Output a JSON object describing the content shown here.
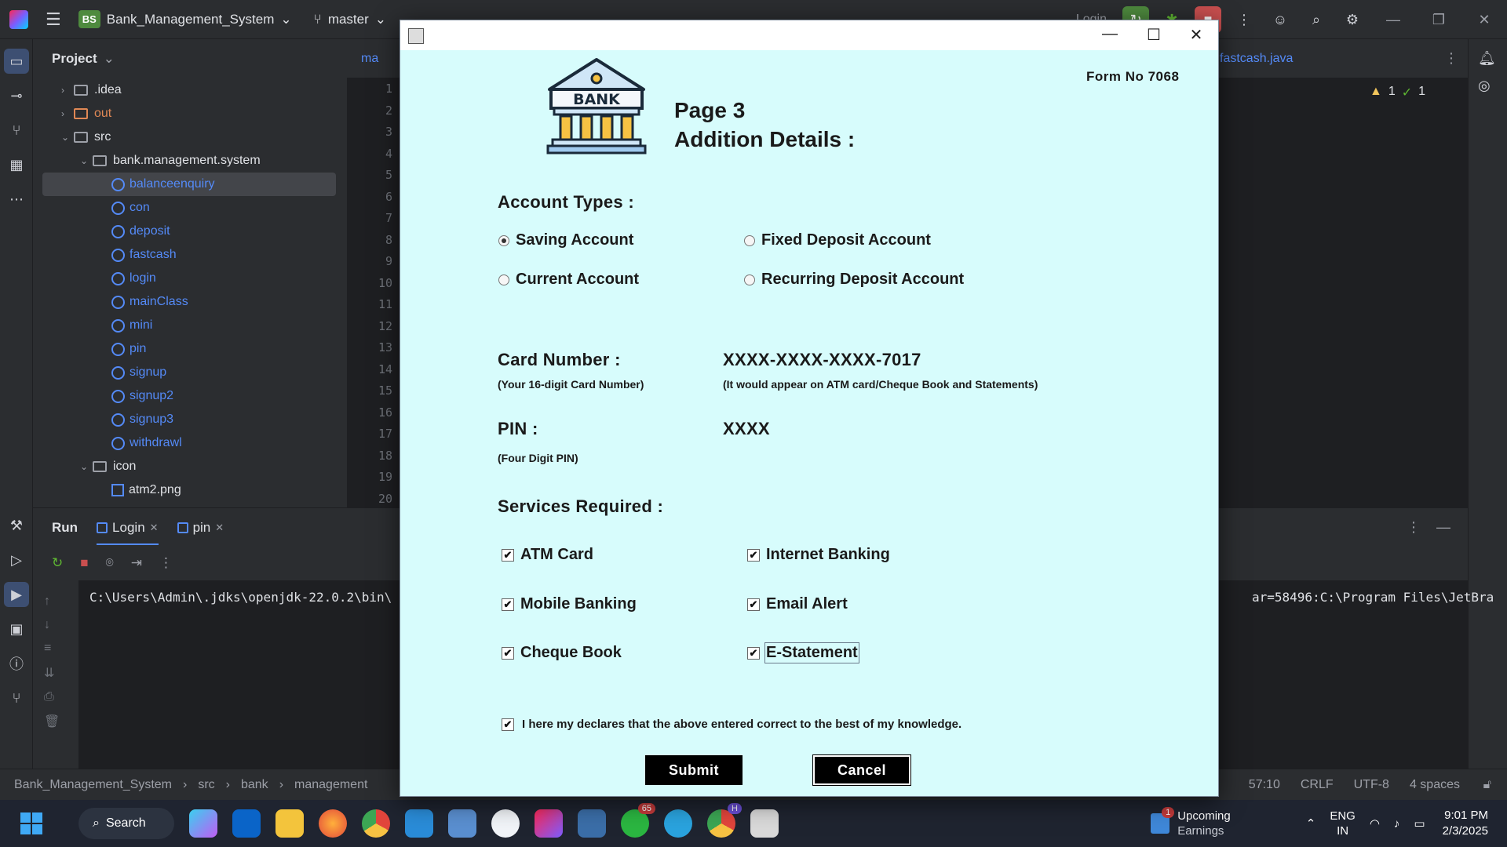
{
  "ide": {
    "project_name": "Bank_Management_System",
    "project_badge": "BS",
    "branch": "master",
    "run_config": "Login",
    "project_panel_title": "Project",
    "tree": [
      {
        "label": ".idea",
        "kind": "folder",
        "depth": 1,
        "chevron": "›"
      },
      {
        "label": "out",
        "kind": "folder-excluded",
        "depth": 1,
        "chevron": "›"
      },
      {
        "label": "src",
        "kind": "folder",
        "depth": 1,
        "chevron": "⌄"
      },
      {
        "label": "bank.management.system",
        "kind": "package",
        "depth": 2,
        "chevron": "⌄"
      },
      {
        "label": "balanceenquiry",
        "kind": "class",
        "depth": 3,
        "selected": true
      },
      {
        "label": "con",
        "kind": "class",
        "depth": 3
      },
      {
        "label": "deposit",
        "kind": "class",
        "depth": 3
      },
      {
        "label": "fastcash",
        "kind": "class",
        "depth": 3
      },
      {
        "label": "login",
        "kind": "class",
        "depth": 3
      },
      {
        "label": "mainClass",
        "kind": "class",
        "depth": 3
      },
      {
        "label": "mini",
        "kind": "class",
        "depth": 3
      },
      {
        "label": "pin",
        "kind": "class",
        "depth": 3
      },
      {
        "label": "signup",
        "kind": "class",
        "depth": 3
      },
      {
        "label": "signup2",
        "kind": "class",
        "depth": 3
      },
      {
        "label": "signup3",
        "kind": "class",
        "depth": 3
      },
      {
        "label": "withdrawl",
        "kind": "class",
        "depth": 3
      },
      {
        "label": "icon",
        "kind": "package",
        "depth": 2,
        "chevron": "⌄"
      },
      {
        "label": "atm2.png",
        "kind": "image",
        "depth": 3
      }
    ],
    "editor_tab_partial": "ma",
    "editor_tab_right": "fastcash.java",
    "line_numbers": [
      "1",
      "2",
      "3",
      "4",
      "5",
      "6",
      "7",
      "8",
      "9",
      "10",
      "11",
      "12",
      "13",
      "14",
      "15",
      "16",
      "17",
      "18",
      "19",
      "20"
    ],
    "inspections": {
      "warnings": "1",
      "ok": "1"
    },
    "run_panel": {
      "title": "Run",
      "tabs": [
        "Login",
        "pin"
      ],
      "output_left": "C:\\Users\\Admin\\.jdks\\openjdk-22.0.2\\bin\\",
      "output_right": "ar=58496:C:\\Program Files\\JetBra"
    },
    "status": {
      "crumbs": [
        "Bank_Management_System",
        "src",
        "bank",
        "management"
      ],
      "position": "57:10",
      "line_sep": "CRLF",
      "encoding": "UTF-8",
      "indent": "4 spaces"
    }
  },
  "dialog": {
    "form_no": "Form No 7068",
    "logo_text": "BANK",
    "page": "Page 3",
    "heading": "Addition Details :",
    "account_types_label": "Account Types :",
    "account_options": [
      {
        "label": "Saving Account",
        "selected": true
      },
      {
        "label": "Fixed Deposit Account",
        "selected": false
      },
      {
        "label": "Current Account",
        "selected": false
      },
      {
        "label": "Recurring Deposit Account",
        "selected": false
      }
    ],
    "card_label": "Card Number :",
    "card_hint": "(Your 16-digit Card Number)",
    "card_value": "XXXX-XXXX-XXXX-7017",
    "card_note": "(It would appear on ATM card/Cheque Book and Statements)",
    "pin_label": "PIN :",
    "pin_hint": "(Four Digit PIN)",
    "pin_value": "XXXX",
    "services_label": "Services Required :",
    "services": [
      {
        "label": "ATM Card",
        "checked": true
      },
      {
        "label": "Internet Banking",
        "checked": true
      },
      {
        "label": "Mobile Banking",
        "checked": true
      },
      {
        "label": "Email Alert",
        "checked": true
      },
      {
        "label": "Cheque Book",
        "checked": true
      },
      {
        "label": "E-Statement",
        "checked": true
      }
    ],
    "declaration": "I here my declares that the above entered correct to the best of my knowledge.",
    "submit": "Submit",
    "cancel": "Cancel"
  },
  "taskbar": {
    "search": "Search",
    "whatsapp_badge": "65",
    "chrome_badge": "H",
    "earnings_badge": "1",
    "earnings_title": "Upcoming",
    "earnings_sub": "Earnings",
    "lang": "ENG",
    "region": "IN",
    "time": "9:01 PM",
    "date": "2/3/2025"
  },
  "colors": {
    "dialog_bg": "#d7fcfc",
    "ide_bg": "#1e1f22",
    "panel_bg": "#2b2d30",
    "accent": "#548af7"
  }
}
